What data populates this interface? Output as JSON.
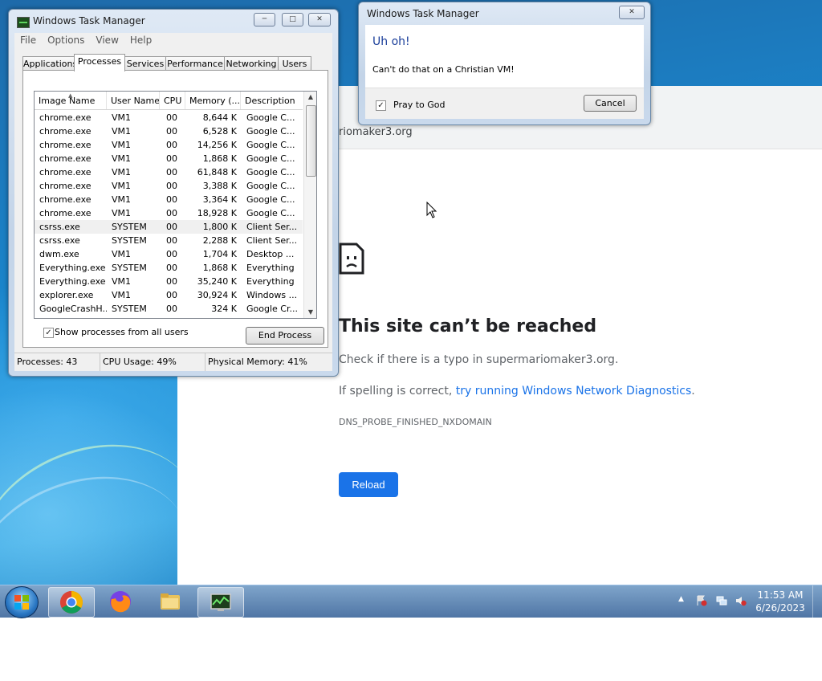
{
  "browser": {
    "address_partial": "riomaker3.org",
    "error_title": "This site can’t be reached",
    "error_line1": "Check if there is a typo in supermariomaker3.org.",
    "error_line2_prefix": "If spelling is correct, ",
    "error_line2_link": "try running Windows Network Diagnostics",
    "error_line2_suffix": ".",
    "error_code": "DNS_PROBE_FINISHED_NXDOMAIN",
    "reload_label": "Reload",
    "accent_color": "#1a73e8"
  },
  "task_manager": {
    "title": "Windows Task Manager",
    "menu": [
      "File",
      "Options",
      "View",
      "Help"
    ],
    "tabs": [
      "Applications",
      "Processes",
      "Services",
      "Performance",
      "Networking",
      "Users"
    ],
    "active_tab": "Processes",
    "columns": [
      "Image Name",
      "User Name",
      "CPU",
      "Memory (...",
      "Description"
    ],
    "rows": [
      {
        "name": "chrome.exe",
        "user": "VM1",
        "cpu": "00",
        "mem": "8,644 K",
        "desc": "Google C..."
      },
      {
        "name": "chrome.exe",
        "user": "VM1",
        "cpu": "00",
        "mem": "6,528 K",
        "desc": "Google C..."
      },
      {
        "name": "chrome.exe",
        "user": "VM1",
        "cpu": "00",
        "mem": "14,256 K",
        "desc": "Google C..."
      },
      {
        "name": "chrome.exe",
        "user": "VM1",
        "cpu": "00",
        "mem": "1,868 K",
        "desc": "Google C..."
      },
      {
        "name": "chrome.exe",
        "user": "VM1",
        "cpu": "00",
        "mem": "61,848 K",
        "desc": "Google C..."
      },
      {
        "name": "chrome.exe",
        "user": "VM1",
        "cpu": "00",
        "mem": "3,388 K",
        "desc": "Google C..."
      },
      {
        "name": "chrome.exe",
        "user": "VM1",
        "cpu": "00",
        "mem": "3,364 K",
        "desc": "Google C..."
      },
      {
        "name": "chrome.exe",
        "user": "VM1",
        "cpu": "00",
        "mem": "18,928 K",
        "desc": "Google C..."
      },
      {
        "name": "csrss.exe",
        "user": "SYSTEM",
        "cpu": "00",
        "mem": "1,800 K",
        "desc": "Client Ser..."
      },
      {
        "name": "csrss.exe",
        "user": "SYSTEM",
        "cpu": "00",
        "mem": "2,288 K",
        "desc": "Client Ser..."
      },
      {
        "name": "dwm.exe",
        "user": "VM1",
        "cpu": "00",
        "mem": "1,704 K",
        "desc": "Desktop ..."
      },
      {
        "name": "Everything.exe",
        "user": "SYSTEM",
        "cpu": "00",
        "mem": "1,868 K",
        "desc": "Everything"
      },
      {
        "name": "Everything.exe",
        "user": "VM1",
        "cpu": "00",
        "mem": "35,240 K",
        "desc": "Everything"
      },
      {
        "name": "explorer.exe",
        "user": "VM1",
        "cpu": "00",
        "mem": "30,924 K",
        "desc": "Windows ..."
      },
      {
        "name": "GoogleCrashH...",
        "user": "SYSTEM",
        "cpu": "00",
        "mem": "324 K",
        "desc": "Google Cr..."
      }
    ],
    "selected_row": 8,
    "show_all_label": "Show processes from all users",
    "show_all_checked": true,
    "end_process_label": "End Process",
    "status_processes": "Processes: 43",
    "status_cpu": "CPU Usage: 49%",
    "status_memory": "Physical Memory: 41%"
  },
  "dialog": {
    "title": "Windows Task Manager",
    "heading": "Uh oh!",
    "message": "Can't do that on a Christian VM!",
    "checkbox_label": "Pray to God",
    "checkbox_checked": true,
    "cancel_label": "Cancel"
  },
  "taskbar": {
    "apps": [
      "chrome-icon",
      "firefox-icon",
      "folder-icon",
      "task-manager-icon"
    ],
    "time": "11:53 AM",
    "date": "6/26/2023"
  }
}
